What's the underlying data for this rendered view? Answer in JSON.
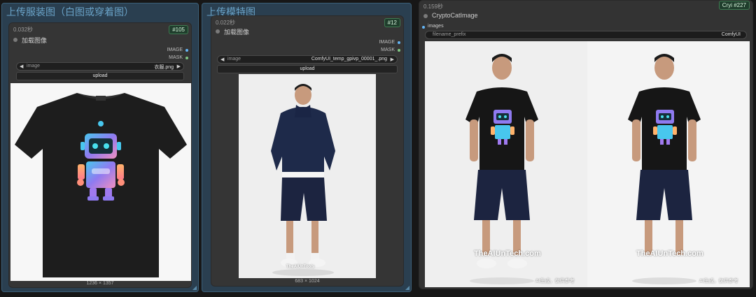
{
  "group1": {
    "title": "上传服装图（白图或穿着图）"
  },
  "group2": {
    "title": "上传模特图"
  },
  "node1": {
    "time": "0.032秒",
    "badge": "#105",
    "title": "加载图像",
    "outputs": [
      "IMAGE",
      "MASK"
    ],
    "widget": {
      "name": "image",
      "value": "衣服.png"
    },
    "button": "upload",
    "dims": "1236 × 1357"
  },
  "node2": {
    "time": "0.022秒",
    "badge": "#12",
    "title": "加载图像",
    "outputs": [
      "IMAGE",
      "MASK"
    ],
    "widget": {
      "name": "image",
      "value": "ComfyUI_temp_gpivp_00001_.png"
    },
    "button": "upload",
    "dims": "683 × 1024",
    "watermark": "TheAIUnTools"
  },
  "node3": {
    "time": "0.159秒",
    "badge_prefix": "Cryi",
    "badge": "#227",
    "title": "CryptoCatImage",
    "input": "images",
    "text_widget": {
      "name": "filename_prefix",
      "value": "ComfyUI"
    },
    "watermark": "TheAIUnTech.com",
    "watermark_cn": "AI生成，仅供参考"
  },
  "colors": {
    "group_border": "#3b5f78",
    "group_bg": "#253644",
    "image_slot": "#64b5f6",
    "mask_slot": "#81c784"
  }
}
